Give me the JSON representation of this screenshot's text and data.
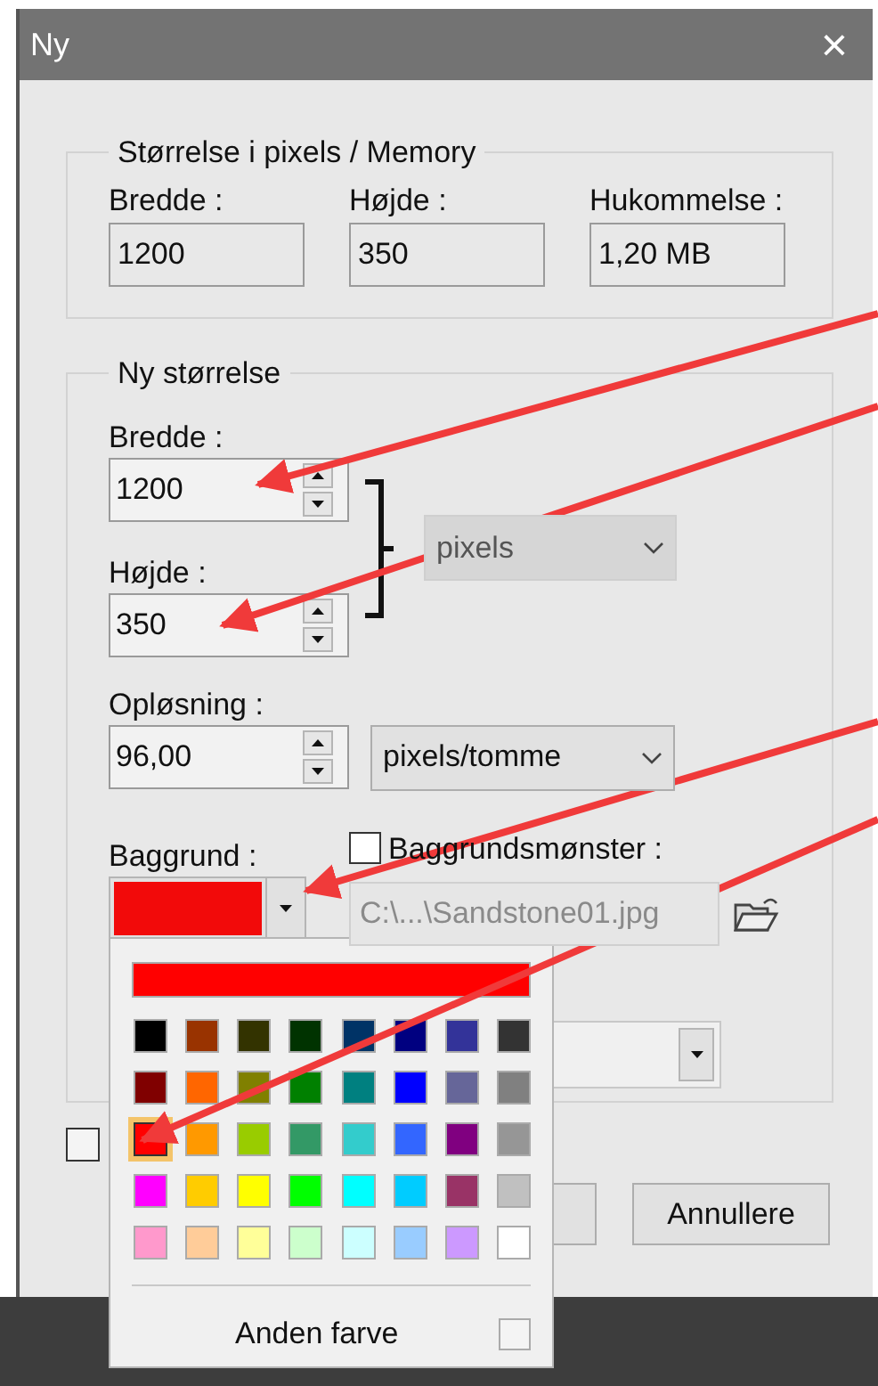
{
  "window": {
    "title": "Ny",
    "close": "×"
  },
  "memory_group": {
    "legend": "Størrelse i pixels / Memory",
    "fields": [
      {
        "label": "Bredde :",
        "value": "1200"
      },
      {
        "label": "Højde :",
        "value": "350"
      },
      {
        "label": "Hukommelse :",
        "value": "1,20 MB"
      }
    ]
  },
  "new_size_group": {
    "legend": "Ny størrelse",
    "width": {
      "label": "Bredde :",
      "value": "1200"
    },
    "height": {
      "label": "Højde :",
      "value": "350"
    },
    "size_unit": {
      "value": "pixels",
      "disabled": true
    },
    "resolution": {
      "label": "Opløsning :",
      "value": "96,00"
    },
    "resolution_unit": {
      "value": "pixels/tomme",
      "disabled": false
    },
    "background": {
      "label": "Baggrund :",
      "color": "#f20a0a"
    },
    "pattern": {
      "label": "Baggrundsmønster :",
      "checked": false,
      "path": "C:\\...\\Sandstone01.jpg",
      "disabled": true
    }
  },
  "bottom_checkbox": {
    "checked": false
  },
  "buttons": [
    {
      "kind": "covered"
    },
    {
      "kind": "text",
      "label": "Annullere"
    }
  ],
  "color_popup": {
    "current": {
      "color": "#ff0000"
    },
    "swatches": [
      {
        "color": "#000000",
        "selected": false
      },
      {
        "color": "#993300",
        "selected": false
      },
      {
        "color": "#333300",
        "selected": false
      },
      {
        "color": "#003300",
        "selected": false
      },
      {
        "color": "#003366",
        "selected": false
      },
      {
        "color": "#000080",
        "selected": false
      },
      {
        "color": "#333399",
        "selected": false
      },
      {
        "color": "#333333",
        "selected": false
      },
      {
        "color": "#800000",
        "selected": false
      },
      {
        "color": "#ff6600",
        "selected": false
      },
      {
        "color": "#808000",
        "selected": false
      },
      {
        "color": "#008000",
        "selected": false
      },
      {
        "color": "#008080",
        "selected": false
      },
      {
        "color": "#0000ff",
        "selected": false
      },
      {
        "color": "#666699",
        "selected": false
      },
      {
        "color": "#808080",
        "selected": false
      },
      {
        "color": "#ff0000",
        "selected": true
      },
      {
        "color": "#ff9900",
        "selected": false
      },
      {
        "color": "#99cc00",
        "selected": false
      },
      {
        "color": "#339966",
        "selected": false
      },
      {
        "color": "#33cccc",
        "selected": false
      },
      {
        "color": "#3366ff",
        "selected": false
      },
      {
        "color": "#800080",
        "selected": false
      },
      {
        "color": "#969696",
        "selected": false
      },
      {
        "color": "#ff00ff",
        "selected": false
      },
      {
        "color": "#ffcc00",
        "selected": false
      },
      {
        "color": "#ffff00",
        "selected": false
      },
      {
        "color": "#00ff00",
        "selected": false
      },
      {
        "color": "#00ffff",
        "selected": false
      },
      {
        "color": "#00ccff",
        "selected": false
      },
      {
        "color": "#993366",
        "selected": false
      },
      {
        "color": "#c0c0c0",
        "selected": false
      },
      {
        "color": "#ff99cc",
        "selected": false
      },
      {
        "color": "#ffcc99",
        "selected": false
      },
      {
        "color": "#ffff99",
        "selected": false
      },
      {
        "color": "#ccffcc",
        "selected": false
      },
      {
        "color": "#ccffff",
        "selected": false
      },
      {
        "color": "#99ccff",
        "selected": false
      },
      {
        "color": "#cc99ff",
        "selected": false
      },
      {
        "color": "#ffffff",
        "selected": false
      }
    ],
    "other_color": {
      "label": "Anden farve",
      "checked": false
    }
  }
}
